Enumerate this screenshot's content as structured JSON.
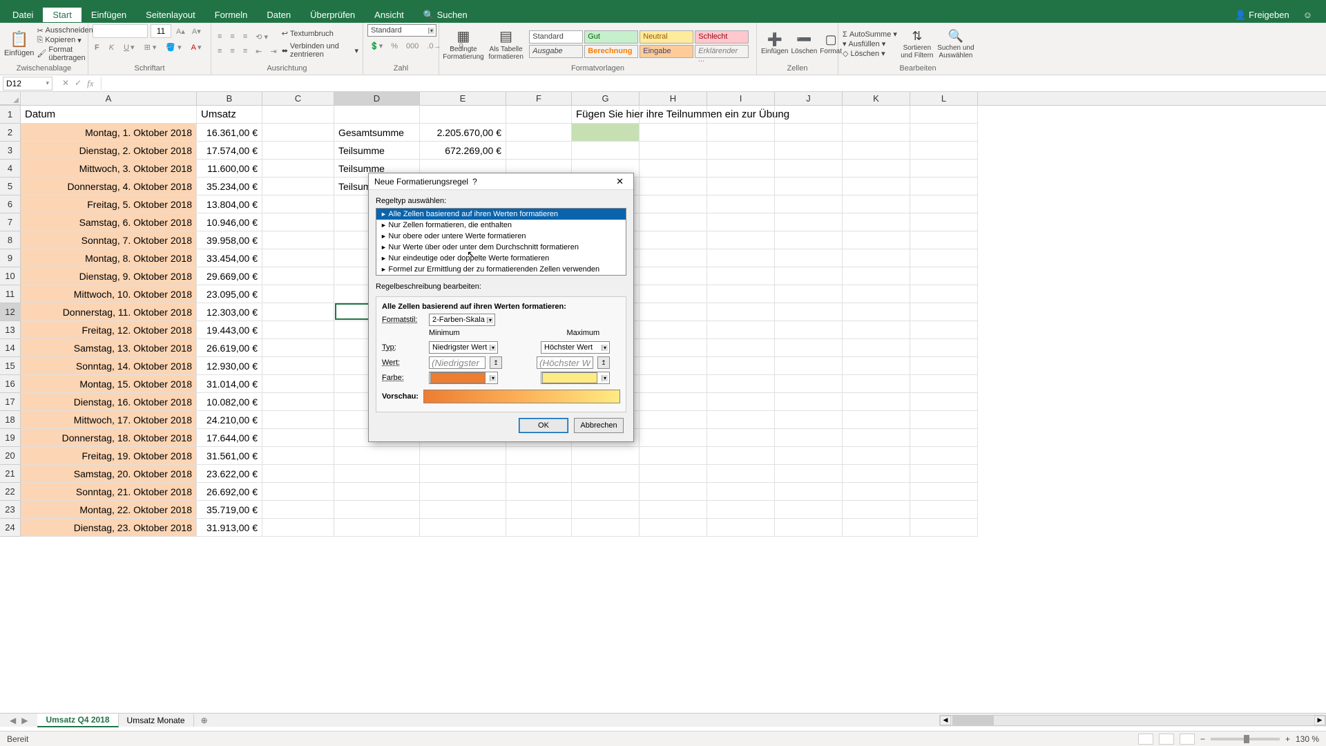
{
  "menubar": {
    "file": "Datei",
    "tabs": [
      "Start",
      "Einfügen",
      "Seitenlayout",
      "Formeln",
      "Daten",
      "Überprüfen",
      "Ansicht"
    ],
    "search_icon": "⌕",
    "search": "Suchen",
    "share": "Freigeben",
    "right_icon": "☺"
  },
  "ribbon": {
    "clipboard": {
      "paste": "Einfügen",
      "cut": "Ausschneiden",
      "copy": "Kopieren",
      "format_painter": "Format übertragen",
      "label": "Zwischenablage"
    },
    "font": {
      "size": "11",
      "label": "Schriftart"
    },
    "alignment": {
      "wrap": "Textumbruch",
      "merge": "Verbinden und zentrieren",
      "label": "Ausrichtung"
    },
    "number": {
      "format": "Standard",
      "label": "Zahl"
    },
    "styles": {
      "cond": "Bedingte Formatierung",
      "table": "Als Tabelle formatieren",
      "boxes": {
        "standard": "Standard",
        "gut": "Gut",
        "neutral": "Neutral",
        "schlecht": "Schlecht",
        "ausgabe": "Ausgabe",
        "berechnung": "Berechnung",
        "eingabe": "Eingabe",
        "erklarend": "Erklärender ..."
      },
      "label": "Formatvorlagen"
    },
    "cells": {
      "insert": "Einfügen",
      "delete": "Löschen",
      "format": "Format",
      "label": "Zellen"
    },
    "editing": {
      "autosum": "AutoSumme",
      "fill": "Ausfüllen",
      "clear": "Löschen",
      "sort": "Sortieren und Filtern",
      "find": "Suchen und Auswählen",
      "label": "Bearbeiten"
    }
  },
  "namebox": "D12",
  "columns": [
    "A",
    "B",
    "C",
    "D",
    "E",
    "F",
    "G",
    "H",
    "I",
    "J",
    "K",
    "L"
  ],
  "rows": [
    {
      "n": 1,
      "A": "Datum",
      "B": "Umsatz",
      "G": "Fügen Sie hier ihre Teilnummen ein zur Übung"
    },
    {
      "n": 2,
      "A": "Montag, 1. Oktober 2018",
      "B": "16.361,00 €",
      "D": "Gesamtsumme",
      "E": "2.205.670,00 €"
    },
    {
      "n": 3,
      "A": "Dienstag, 2. Oktober 2018",
      "B": "17.574,00 €",
      "D": "Teilsumme",
      "E": "672.269,00 €"
    },
    {
      "n": 4,
      "A": "Mittwoch, 3. Oktober 2018",
      "B": "11.600,00 €",
      "D": "Teilsumme"
    },
    {
      "n": 5,
      "A": "Donnerstag, 4. Oktober 2018",
      "B": "35.234,00 €",
      "D": "Teilsumme"
    },
    {
      "n": 6,
      "A": "Freitag, 5. Oktober 2018",
      "B": "13.804,00 €"
    },
    {
      "n": 7,
      "A": "Samstag, 6. Oktober 2018",
      "B": "10.946,00 €"
    },
    {
      "n": 8,
      "A": "Sonntag, 7. Oktober 2018",
      "B": "39.958,00 €"
    },
    {
      "n": 9,
      "A": "Montag, 8. Oktober 2018",
      "B": "33.454,00 €"
    },
    {
      "n": 10,
      "A": "Dienstag, 9. Oktober 2018",
      "B": "29.669,00 €"
    },
    {
      "n": 11,
      "A": "Mittwoch, 10. Oktober 2018",
      "B": "23.095,00 €"
    },
    {
      "n": 12,
      "A": "Donnerstag, 11. Oktober 2018",
      "B": "12.303,00 €"
    },
    {
      "n": 13,
      "A": "Freitag, 12. Oktober 2018",
      "B": "19.443,00 €"
    },
    {
      "n": 14,
      "A": "Samstag, 13. Oktober 2018",
      "B": "26.619,00 €"
    },
    {
      "n": 15,
      "A": "Sonntag, 14. Oktober 2018",
      "B": "12.930,00 €"
    },
    {
      "n": 16,
      "A": "Montag, 15. Oktober 2018",
      "B": "31.014,00 €"
    },
    {
      "n": 17,
      "A": "Dienstag, 16. Oktober 2018",
      "B": "10.082,00 €"
    },
    {
      "n": 18,
      "A": "Mittwoch, 17. Oktober 2018",
      "B": "24.210,00 €"
    },
    {
      "n": 19,
      "A": "Donnerstag, 18. Oktober 2018",
      "B": "17.644,00 €"
    },
    {
      "n": 20,
      "A": "Freitag, 19. Oktober 2018",
      "B": "31.561,00 €"
    },
    {
      "n": 21,
      "A": "Samstag, 20. Oktober 2018",
      "B": "23.622,00 €"
    },
    {
      "n": 22,
      "A": "Sonntag, 21. Oktober 2018",
      "B": "26.692,00 €"
    },
    {
      "n": 23,
      "A": "Montag, 22. Oktober 2018",
      "B": "35.719,00 €"
    },
    {
      "n": 24,
      "A": "Dienstag, 23. Oktober 2018",
      "B": "31.913,00 €"
    }
  ],
  "sheets": {
    "active": "Umsatz Q4 2018",
    "other": "Umsatz Monate"
  },
  "status": {
    "ready": "Bereit",
    "zoom": "130 %"
  },
  "dialog": {
    "title": "Neue Formatierungsregel",
    "rule_label": "Regeltyp auswählen:",
    "rules": [
      "Alle Zellen basierend auf ihren Werten formatieren",
      "Nur Zellen formatieren, die enthalten",
      "Nur obere oder untere Werte formatieren",
      "Nur Werte über oder unter dem Durchschnitt formatieren",
      "Nur eindeutige oder doppelte Werte formatieren",
      "Formel zur Ermittlung der zu formatierenden Zellen verwenden"
    ],
    "desc_label": "Regelbeschreibung bearbeiten:",
    "desc_header": "Alle Zellen basierend auf ihren Werten formatieren:",
    "format_style_label": "Formatstil:",
    "format_style": "2-Farben-Skala",
    "min_label": "Minimum",
    "max_label": "Maximum",
    "type_label": "Typ:",
    "type_min": "Niedrigster Wert",
    "type_max": "Höchster Wert",
    "value_label": "Wert:",
    "value_min": "(Niedrigster Wert)",
    "value_max": "(Höchster Wert)",
    "color_label": "Farbe:",
    "preview_label": "Vorschau:",
    "ok": "OK",
    "cancel": "Abbrechen"
  }
}
